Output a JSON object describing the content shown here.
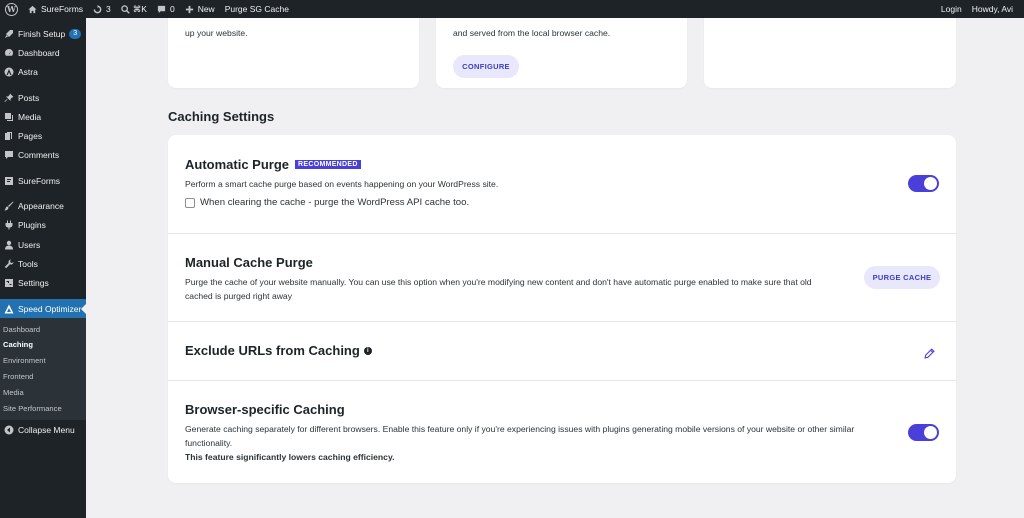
{
  "adminbar": {
    "site_name": "SureForms",
    "updates_count": "3",
    "shortcut": "⌘K",
    "comments_count": "0",
    "new_label": "New",
    "purge_label": "Purge SG Cache",
    "login_label": "Login",
    "howdy_label": "Howdy, Avi"
  },
  "sidebar": {
    "finish_setup": "Finish Setup",
    "finish_setup_badge": "3",
    "dashboard": "Dashboard",
    "astra": "Astra",
    "posts": "Posts",
    "media": "Media",
    "pages": "Pages",
    "comments": "Comments",
    "sureforms": "SureForms",
    "appearance": "Appearance",
    "plugins": "Plugins",
    "users": "Users",
    "tools": "Tools",
    "settings": "Settings",
    "speed_optimizer": "Speed Optimizer",
    "submenu": [
      "Dashboard",
      "Caching",
      "Environment",
      "Frontend",
      "Media",
      "Site Performance"
    ],
    "collapse": "Collapse Menu"
  },
  "top_cards": {
    "card1_text": "up your website.",
    "card2_text": "and served from the local browser cache.",
    "configure_label": "CONFIGURE"
  },
  "section_title": "Caching Settings",
  "auto_purge": {
    "title": "Automatic Purge",
    "badge": "RECOMMENDED",
    "desc": "Perform a smart cache purge based on events happening on your WordPress site.",
    "checkbox_label": "When clearing the cache - purge the WordPress API cache too."
  },
  "manual_purge": {
    "title": "Manual Cache Purge",
    "desc_line1": "Purge the cache of your website manually. You can use this option when you're modifying new content and don't have automatic purge enabled to make sure that old",
    "desc_line2": "cached is purged right away",
    "button_label": "PURGE CACHE"
  },
  "exclude_urls": {
    "title": "Exclude URLs from Caching"
  },
  "browser_caching": {
    "title": "Browser-specific Caching",
    "desc_line1": "Generate caching separately for different browsers. Enable this feature only if you're experiencing issues with plugins generating mobile versions of your website or other similar",
    "desc_line2": "functionality.",
    "warning": "This feature significantly lowers caching efficiency."
  },
  "colors": {
    "accent": "#4a3fd9",
    "wp_blue": "#2271b1",
    "sidebar_bg": "#1d2327"
  }
}
